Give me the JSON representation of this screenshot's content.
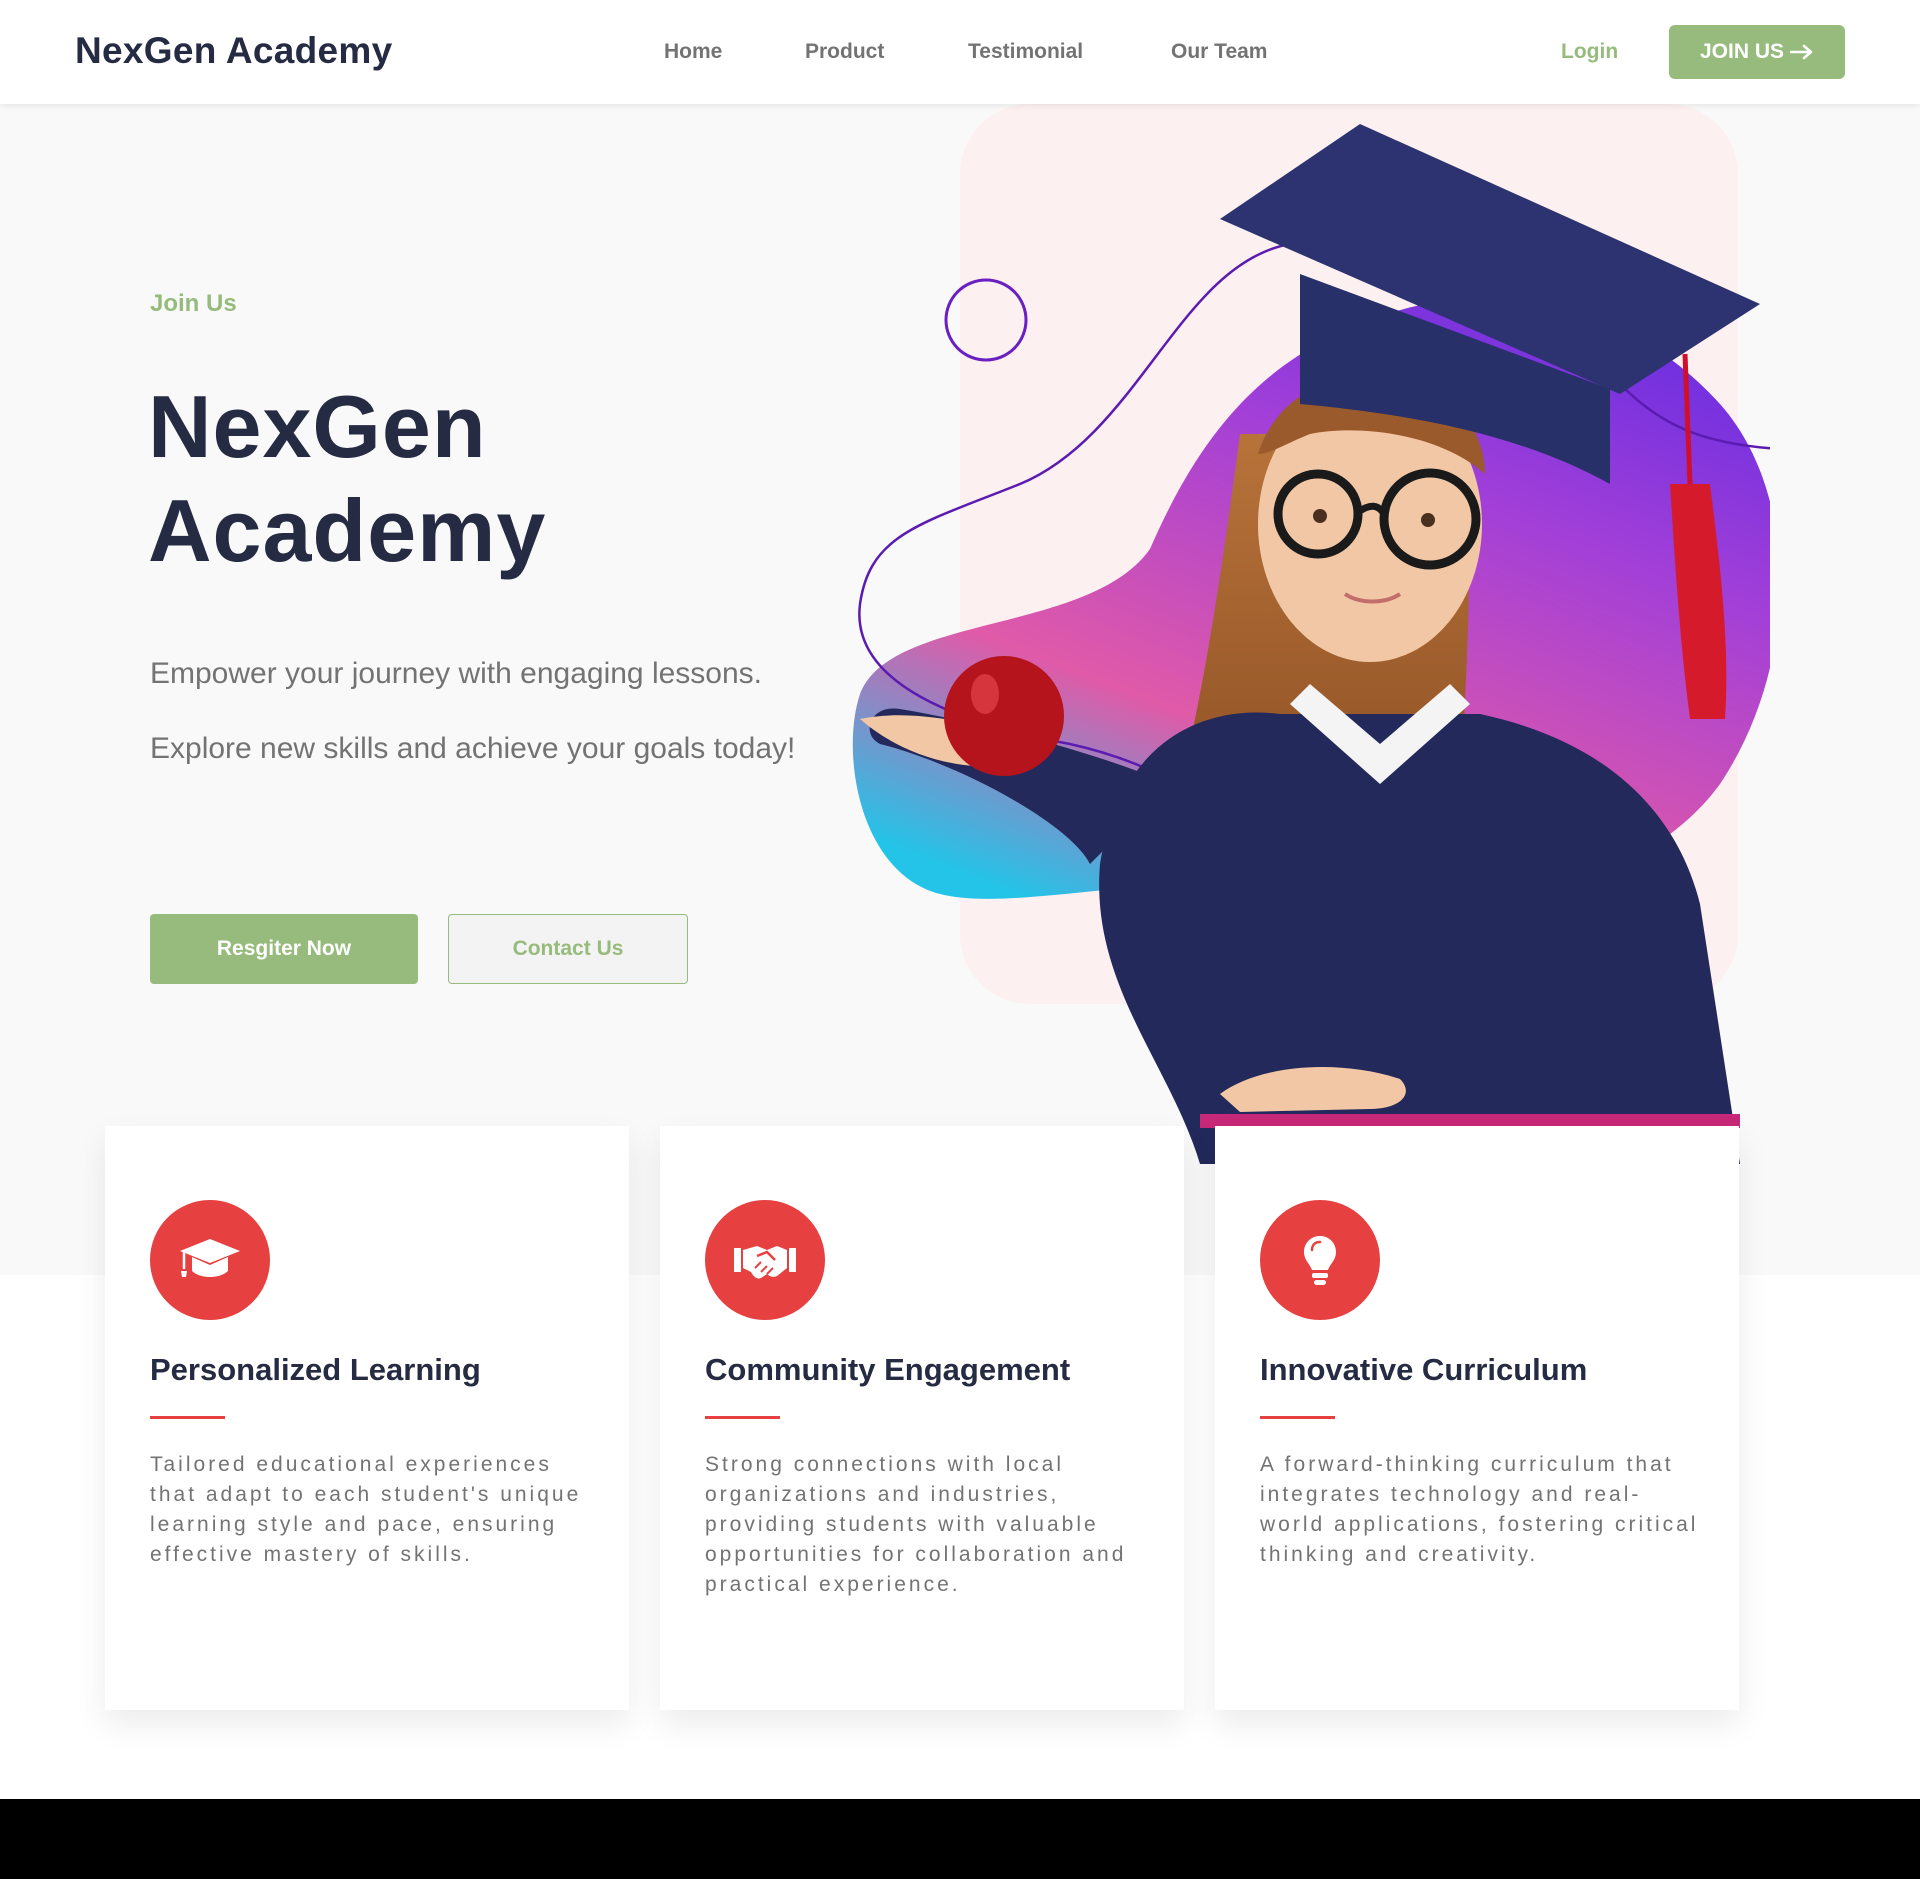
{
  "header": {
    "brand": "NexGen Academy",
    "nav": [
      {
        "label": "Home"
      },
      {
        "label": "Product"
      },
      {
        "label": "Testimonial"
      },
      {
        "label": "Our Team"
      }
    ],
    "login_label": "Login",
    "join_label": "JOIN US",
    "join_icon": "arrow-right-icon"
  },
  "hero": {
    "eyebrow": "Join Us",
    "title_line1": "NexGen",
    "title_line2": "Academy",
    "description": "Empower your journey with engaging lessons. Explore new skills and achieve your goals today!",
    "register_label": "Resgiter Now",
    "contact_label": "Contact Us"
  },
  "features": [
    {
      "icon": "graduation-cap-icon",
      "title": "Personalized Learning",
      "description": "Tailored educational experiences that adapt to each student's unique learning style and pace, ensuring effective mastery of skills."
    },
    {
      "icon": "handshake-icon",
      "title": "Community Engagement",
      "description": "Strong connections with local organizations and industries, providing students with valuable opportunities for collaboration and practical experience."
    },
    {
      "icon": "lightbulb-icon",
      "title": "Innovative Curriculum",
      "description": "A forward-thinking curriculum that integrates technology and real-world applications, fostering critical thinking and creativity."
    }
  ],
  "colors": {
    "primary_dark": "#252b42",
    "accent_green": "#96bb7c",
    "accent_red": "#e74040",
    "muted_text": "#737373",
    "hero_bg": "#f9f9f9"
  }
}
